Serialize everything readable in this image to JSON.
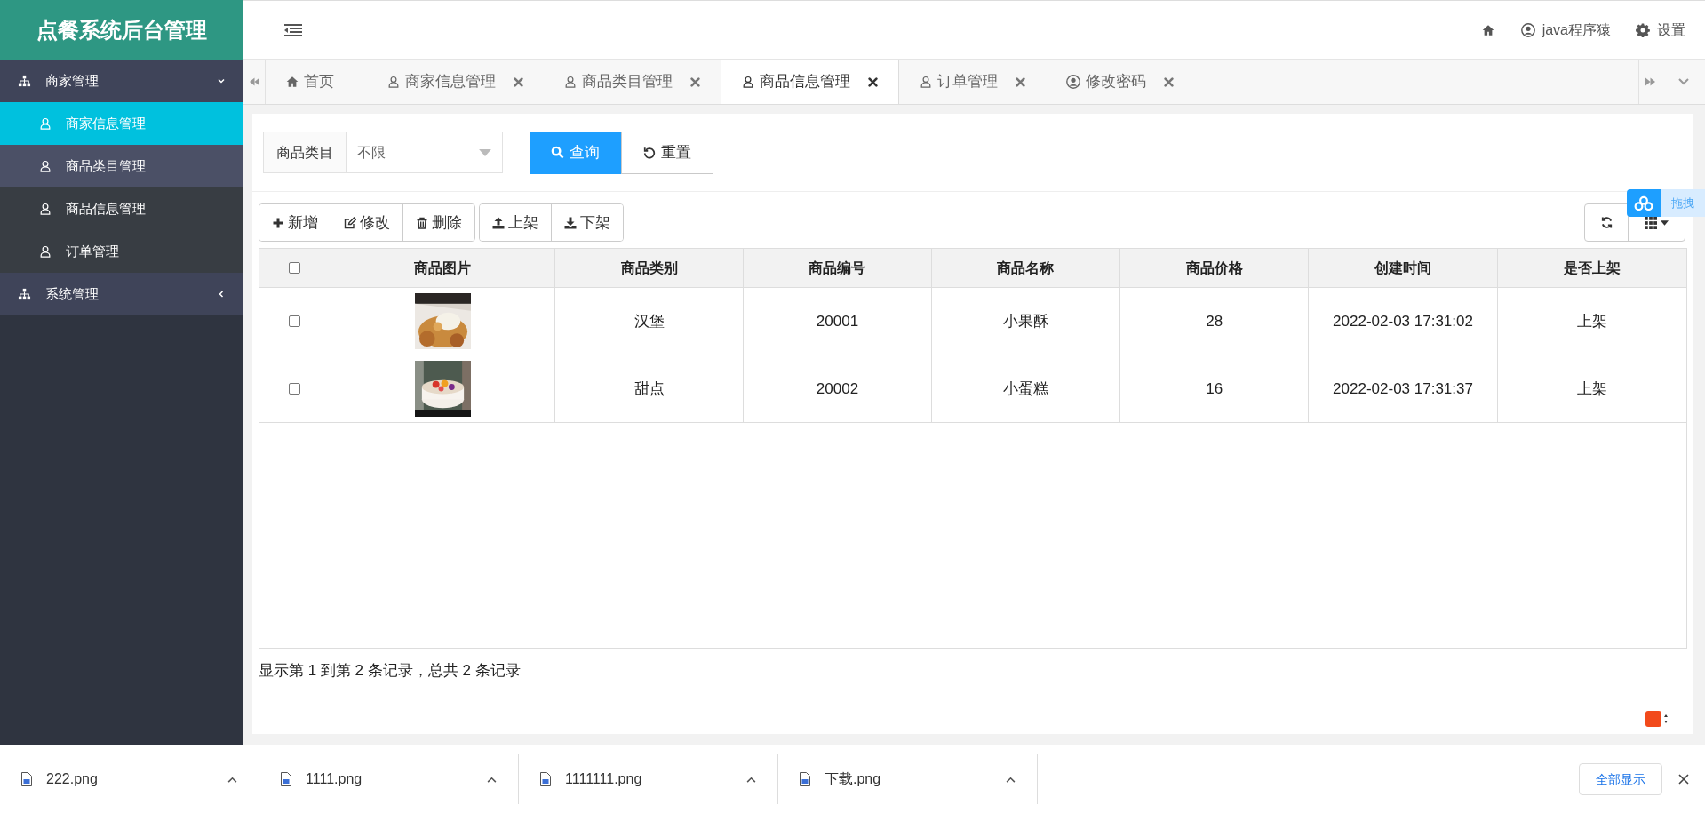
{
  "app_title": "点餐系统后台管理",
  "header": {
    "user": "java程序猿",
    "settings": "设置"
  },
  "sidebar": [
    {
      "label": "商家管理",
      "expanded": true,
      "children": [
        {
          "label": "商家信息管理",
          "selected": true,
          "hovered": false
        },
        {
          "label": "商品类目管理",
          "selected": false,
          "hovered": true
        },
        {
          "label": "商品信息管理",
          "selected": false,
          "hovered": false
        },
        {
          "label": "订单管理",
          "selected": false,
          "hovered": false
        }
      ]
    },
    {
      "label": "系统管理",
      "expanded": false
    }
  ],
  "tabs": [
    {
      "label": "首页",
      "kind": "home",
      "closable": false,
      "selected": false
    },
    {
      "label": "商家信息管理",
      "kind": "user",
      "closable": true,
      "selected": false
    },
    {
      "label": "商品类目管理",
      "kind": "user",
      "closable": true,
      "selected": false
    },
    {
      "label": "商品信息管理",
      "kind": "user",
      "closable": true,
      "selected": true
    },
    {
      "label": "订单管理",
      "kind": "user",
      "closable": true,
      "selected": false
    },
    {
      "label": "修改密码",
      "kind": "account",
      "closable": true,
      "selected": false
    }
  ],
  "filter": {
    "label": "商品类目",
    "value": "不限",
    "search_button": "查询",
    "reset_button": "重置"
  },
  "toolbar": [
    [
      {
        "label": "新增",
        "kind": "add"
      },
      {
        "label": "修改",
        "kind": "edit"
      },
      {
        "label": "删除",
        "kind": "delete"
      }
    ],
    [
      {
        "label": "上架",
        "kind": "publish"
      },
      {
        "label": "下架",
        "kind": "unpublish"
      }
    ]
  ],
  "table": {
    "header_checked": false,
    "columns": [
      "商品图片",
      "商品类别",
      "商品编号",
      "商品名称",
      "商品价格",
      "创建时间",
      "是否上架"
    ],
    "rows": [
      {
        "checked": false,
        "cells": [
          {
            "kind": "picture"
          },
          {
            "kind": "text",
            "text": "汉堡"
          },
          {
            "kind": "text",
            "text": "20001"
          },
          {
            "kind": "text",
            "text": "小果酥"
          },
          {
            "kind": "text",
            "text": "28"
          },
          {
            "kind": "text",
            "text": "2022-02-03 17:31:02"
          },
          {
            "kind": "text",
            "text": "上架"
          }
        ]
      },
      {
        "checked": false,
        "cells": [
          {
            "kind": "picture"
          },
          {
            "kind": "text",
            "text": "甜点"
          },
          {
            "kind": "text",
            "text": "20002"
          },
          {
            "kind": "text",
            "text": "小蛋糕"
          },
          {
            "kind": "text",
            "text": "16"
          },
          {
            "kind": "text",
            "text": "2022-02-03 17:31:37"
          },
          {
            "kind": "text",
            "text": "上架"
          }
        ]
      }
    ]
  },
  "pagination": "显示第 1 到第 2 条记录，总共 2 条记录",
  "drag_widget": "拖拽",
  "downloads": [
    "222.png",
    "1111.png",
    "1111111.png",
    "下载.png"
  ],
  "show_all": "全部显示"
}
